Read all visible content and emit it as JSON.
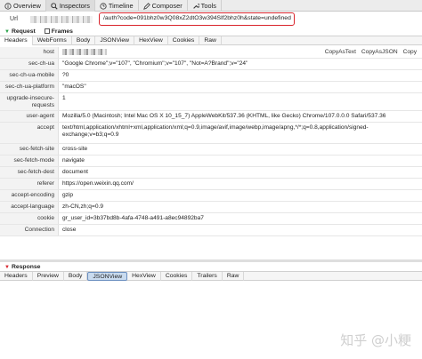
{
  "toolbar": {
    "tabs": [
      {
        "label": "Overview",
        "icon": "info-circle-icon"
      },
      {
        "label": "Inspectors",
        "icon": "magnifier-icon"
      },
      {
        "label": "Timeline",
        "icon": "clock-icon"
      },
      {
        "label": "Composer",
        "icon": "pencil-icon"
      },
      {
        "label": "Tools",
        "icon": "wrench-icon"
      }
    ]
  },
  "url": {
    "label": "Url",
    "value": "/auth?code=091bhz0w3Q08xZ2dtO3w394Slf2bhz0h&state=undefined"
  },
  "request": {
    "label": "Request",
    "frames_label": "Frames",
    "tabs": [
      "Headers",
      "WebForms",
      "Body",
      "JSONView",
      "HexView",
      "Cookies",
      "Raw"
    ],
    "copy_as_text": "CopyAsText",
    "copy_as_json": "CopyAsJSON",
    "copy_trailing": "Copy",
    "headers": [
      {
        "key": "host",
        "value": ""
      },
      {
        "key": "sec-ch-ua",
        "value": "\"Google Chrome\";v=\"107\", \"Chromium\";v=\"107\", \"Not=A?Brand\";v=\"24\""
      },
      {
        "key": "sec-ch-ua-mobile",
        "value": "?0"
      },
      {
        "key": "sec-ch-ua-platform",
        "value": "\"macOS\""
      },
      {
        "key": "upgrade-insecure-\nrequests",
        "value": "1"
      },
      {
        "key": "user-agent",
        "value": "Mozilla/5.0 (Macintosh; Intel Mac OS X 10_15_7) AppleWebKit/537.36 (KHTML, like Gecko) Chrome/107.0.0.0 Safari/537.36"
      },
      {
        "key": "accept",
        "value": "text/html,application/xhtml+xml,application/xml;q=0.9,image/avif,image/webp,image/apng,*/*;q=0.8,application/signed-exchange;v=b3;q=0.9"
      },
      {
        "key": "sec-fetch-site",
        "value": "cross-site"
      },
      {
        "key": "sec-fetch-mode",
        "value": "navigate"
      },
      {
        "key": "sec-fetch-dest",
        "value": "document"
      },
      {
        "key": "referer",
        "value": "https://open.weixin.qq.com/"
      },
      {
        "key": "accept-encoding",
        "value": "gzip"
      },
      {
        "key": "accept-language",
        "value": "zh-CN,zh;q=0.9"
      },
      {
        "key": "cookie",
        "value": "gr_user_id=3b37bd8b-4afa-4748-a491-a8ec94892ba7"
      },
      {
        "key": "Connection",
        "value": "close"
      }
    ]
  },
  "response": {
    "label": "Response",
    "tabs": [
      "Headers",
      "Preview",
      "Body",
      "JSONView",
      "HexView",
      "Cookies",
      "Trailers",
      "Raw"
    ]
  },
  "watermark": "知乎 @小粳"
}
